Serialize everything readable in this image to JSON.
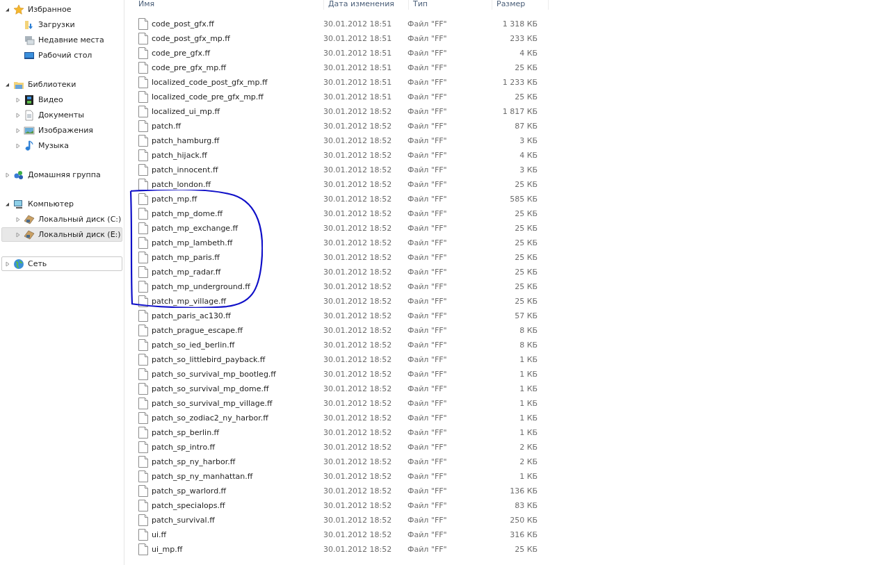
{
  "sidebar": {
    "groups": [
      {
        "label": "Избранное",
        "expanded": true,
        "focused": false,
        "children": [
          {
            "label": "Загрузки",
            "selected": false,
            "expandable": false
          },
          {
            "label": "Недавние места",
            "selected": false,
            "expandable": false
          },
          {
            "label": "Рабочий стол",
            "selected": false,
            "expandable": false
          }
        ]
      },
      {
        "label": "Библиотеки",
        "expanded": true,
        "focused": false,
        "children": [
          {
            "label": "Видео",
            "selected": false,
            "expandable": true
          },
          {
            "label": "Документы",
            "selected": false,
            "expandable": true
          },
          {
            "label": "Изображения",
            "selected": false,
            "expandable": true
          },
          {
            "label": "Музыка",
            "selected": false,
            "expandable": true
          }
        ]
      },
      {
        "label": "Домашняя группа",
        "expanded": false,
        "focused": false
      },
      {
        "label": "Компьютер",
        "expanded": true,
        "focused": false,
        "children": [
          {
            "label": "Локальный диск (C:)",
            "selected": false,
            "expandable": true
          },
          {
            "label": "Локальный диск (E:)",
            "selected": true,
            "expandable": true
          }
        ]
      },
      {
        "label": "Сеть",
        "expanded": false,
        "focused": true
      }
    ]
  },
  "table": {
    "columns": [
      "Имя",
      "Дата изменения",
      "Тип",
      "Размер"
    ],
    "rows": [
      {
        "name": "code_post_gfx.ff",
        "date": "30.01.2012 18:51",
        "type": "Файл \"FF\"",
        "size": "1 318 КБ",
        "circled": false
      },
      {
        "name": "code_post_gfx_mp.ff",
        "date": "30.01.2012 18:51",
        "type": "Файл \"FF\"",
        "size": "233 КБ",
        "circled": false
      },
      {
        "name": "code_pre_gfx.ff",
        "date": "30.01.2012 18:51",
        "type": "Файл \"FF\"",
        "size": "4 КБ",
        "circled": false
      },
      {
        "name": "code_pre_gfx_mp.ff",
        "date": "30.01.2012 18:51",
        "type": "Файл \"FF\"",
        "size": "25 КБ",
        "circled": false
      },
      {
        "name": "localized_code_post_gfx_mp.ff",
        "date": "30.01.2012 18:51",
        "type": "Файл \"FF\"",
        "size": "1 233 КБ",
        "circled": false
      },
      {
        "name": "localized_code_pre_gfx_mp.ff",
        "date": "30.01.2012 18:51",
        "type": "Файл \"FF\"",
        "size": "25 КБ",
        "circled": false
      },
      {
        "name": "localized_ui_mp.ff",
        "date": "30.01.2012 18:52",
        "type": "Файл \"FF\"",
        "size": "1 817 КБ",
        "circled": false
      },
      {
        "name": "patch.ff",
        "date": "30.01.2012 18:52",
        "type": "Файл \"FF\"",
        "size": "87 КБ",
        "circled": false
      },
      {
        "name": "patch_hamburg.ff",
        "date": "30.01.2012 18:52",
        "type": "Файл \"FF\"",
        "size": "3 КБ",
        "circled": false
      },
      {
        "name": "patch_hijack.ff",
        "date": "30.01.2012 18:52",
        "type": "Файл \"FF\"",
        "size": "4 КБ",
        "circled": false
      },
      {
        "name": "patch_innocent.ff",
        "date": "30.01.2012 18:52",
        "type": "Файл \"FF\"",
        "size": "3 КБ",
        "circled": false
      },
      {
        "name": "patch_london.ff",
        "date": "30.01.2012 18:52",
        "type": "Файл \"FF\"",
        "size": "25 КБ",
        "circled": false
      },
      {
        "name": "patch_mp.ff",
        "date": "30.01.2012 18:52",
        "type": "Файл \"FF\"",
        "size": "585 КБ",
        "circled": true
      },
      {
        "name": "patch_mp_dome.ff",
        "date": "30.01.2012 18:52",
        "type": "Файл \"FF\"",
        "size": "25 КБ",
        "circled": true
      },
      {
        "name": "patch_mp_exchange.ff",
        "date": "30.01.2012 18:52",
        "type": "Файл \"FF\"",
        "size": "25 КБ",
        "circled": true
      },
      {
        "name": "patch_mp_lambeth.ff",
        "date": "30.01.2012 18:52",
        "type": "Файл \"FF\"",
        "size": "25 КБ",
        "circled": true
      },
      {
        "name": "patch_mp_paris.ff",
        "date": "30.01.2012 18:52",
        "type": "Файл \"FF\"",
        "size": "25 КБ",
        "circled": true
      },
      {
        "name": "patch_mp_radar.ff",
        "date": "30.01.2012 18:52",
        "type": "Файл \"FF\"",
        "size": "25 КБ",
        "circled": true
      },
      {
        "name": "patch_mp_underground.ff",
        "date": "30.01.2012 18:52",
        "type": "Файл \"FF\"",
        "size": "25 КБ",
        "circled": true
      },
      {
        "name": "patch_mp_village.ff",
        "date": "30.01.2012 18:52",
        "type": "Файл \"FF\"",
        "size": "25 КБ",
        "circled": true
      },
      {
        "name": "patch_paris_ac130.ff",
        "date": "30.01.2012 18:52",
        "type": "Файл \"FF\"",
        "size": "57 КБ",
        "circled": false
      },
      {
        "name": "patch_prague_escape.ff",
        "date": "30.01.2012 18:52",
        "type": "Файл \"FF\"",
        "size": "8 КБ",
        "circled": false
      },
      {
        "name": "patch_so_ied_berlin.ff",
        "date": "30.01.2012 18:52",
        "type": "Файл \"FF\"",
        "size": "8 КБ",
        "circled": false
      },
      {
        "name": "patch_so_littlebird_payback.ff",
        "date": "30.01.2012 18:52",
        "type": "Файл \"FF\"",
        "size": "1 КБ",
        "circled": false
      },
      {
        "name": "patch_so_survival_mp_bootleg.ff",
        "date": "30.01.2012 18:52",
        "type": "Файл \"FF\"",
        "size": "1 КБ",
        "circled": false
      },
      {
        "name": "patch_so_survival_mp_dome.ff",
        "date": "30.01.2012 18:52",
        "type": "Файл \"FF\"",
        "size": "1 КБ",
        "circled": false
      },
      {
        "name": "patch_so_survival_mp_village.ff",
        "date": "30.01.2012 18:52",
        "type": "Файл \"FF\"",
        "size": "1 КБ",
        "circled": false
      },
      {
        "name": "patch_so_zodiac2_ny_harbor.ff",
        "date": "30.01.2012 18:52",
        "type": "Файл \"FF\"",
        "size": "1 КБ",
        "circled": false
      },
      {
        "name": "patch_sp_berlin.ff",
        "date": "30.01.2012 18:52",
        "type": "Файл \"FF\"",
        "size": "1 КБ",
        "circled": false
      },
      {
        "name": "patch_sp_intro.ff",
        "date": "30.01.2012 18:52",
        "type": "Файл \"FF\"",
        "size": "2 КБ",
        "circled": false
      },
      {
        "name": "patch_sp_ny_harbor.ff",
        "date": "30.01.2012 18:52",
        "type": "Файл \"FF\"",
        "size": "2 КБ",
        "circled": false
      },
      {
        "name": "patch_sp_ny_manhattan.ff",
        "date": "30.01.2012 18:52",
        "type": "Файл \"FF\"",
        "size": "1 КБ",
        "circled": false
      },
      {
        "name": "patch_sp_warlord.ff",
        "date": "30.01.2012 18:52",
        "type": "Файл \"FF\"",
        "size": "136 КБ",
        "circled": false
      },
      {
        "name": "patch_specialops.ff",
        "date": "30.01.2012 18:52",
        "type": "Файл \"FF\"",
        "size": "83 КБ",
        "circled": false
      },
      {
        "name": "patch_survival.ff",
        "date": "30.01.2012 18:52",
        "type": "Файл \"FF\"",
        "size": "250 КБ",
        "circled": false
      },
      {
        "name": "ui.ff",
        "date": "30.01.2012 18:52",
        "type": "Файл \"FF\"",
        "size": "316 КБ",
        "circled": false
      },
      {
        "name": "ui_mp.ff",
        "date": "30.01.2012 18:52",
        "type": "Файл \"FF\"",
        "size": "25 КБ",
        "circled": false
      }
    ]
  }
}
